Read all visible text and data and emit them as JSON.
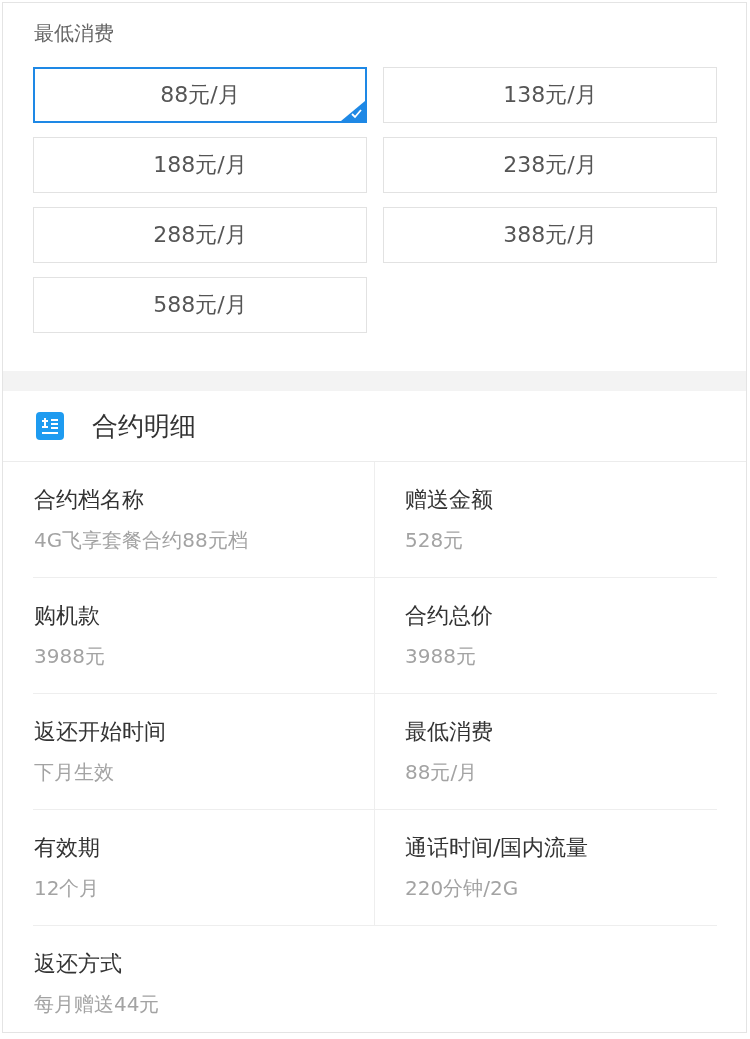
{
  "min_spend": {
    "label": "最低消费",
    "options": [
      {
        "text": "88元/月",
        "selected": true
      },
      {
        "text": "138元/月",
        "selected": false
      },
      {
        "text": "188元/月",
        "selected": false
      },
      {
        "text": "238元/月",
        "selected": false
      },
      {
        "text": "288元/月",
        "selected": false
      },
      {
        "text": "388元/月",
        "selected": false
      },
      {
        "text": "588元/月",
        "selected": false
      }
    ]
  },
  "contract_details": {
    "title": "合约明细",
    "items": [
      {
        "label": "合约档名称",
        "value": "4G飞享套餐合约88元档"
      },
      {
        "label": "赠送金额",
        "value": "528元"
      },
      {
        "label": "购机款",
        "value": "3988元"
      },
      {
        "label": "合约总价",
        "value": "3988元"
      },
      {
        "label": "返还开始时间",
        "value": "下月生效"
      },
      {
        "label": "最低消费",
        "value": "88元/月"
      },
      {
        "label": "有效期",
        "value": "12个月"
      },
      {
        "label": "通话时间/国内流量",
        "value": "220分钟/2G"
      },
      {
        "label": "返还方式",
        "value": "每月赠送44元"
      }
    ]
  }
}
